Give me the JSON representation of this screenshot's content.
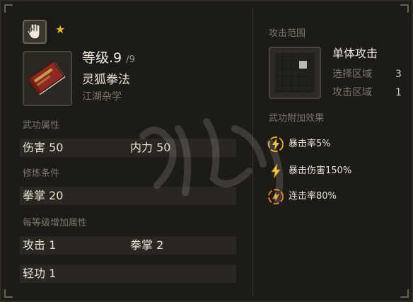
{
  "header": {
    "hand_icon": "hand-icon",
    "star_icon": "star-icon",
    "star_glyph": "★"
  },
  "skill": {
    "level_label": "等级",
    "level_value": ".9",
    "level_max": "/9",
    "name": "灵狐拳法",
    "category": "江湖杂学",
    "book_icon": "book-icon"
  },
  "attributes": {
    "title": "武功属性",
    "items": [
      {
        "label": "伤害",
        "value": "50"
      },
      {
        "label": "内力",
        "value": "50"
      }
    ]
  },
  "requirements": {
    "title": "修炼条件",
    "items": [
      {
        "label": "拳掌",
        "value": "20"
      }
    ]
  },
  "per_level": {
    "title": "每等级增加属性",
    "items": [
      {
        "label": "攻击",
        "value": "1"
      },
      {
        "label": "拳掌",
        "value": "2"
      },
      {
        "label": "轻功",
        "value": "1"
      }
    ]
  },
  "range": {
    "title": "攻击范围",
    "type": "单体攻击",
    "select_label": "选择区域",
    "select_value": "3",
    "attack_label": "攻击区域",
    "attack_value": "1"
  },
  "effects": {
    "title": "武功附加效果",
    "items": [
      {
        "text": "暴击率5%",
        "icon": "lightning-circle-icon"
      },
      {
        "text": "暴击伤害150%",
        "icon": "lightning-icon"
      },
      {
        "text": "连击率80%",
        "icon": "combo-circle-icon"
      }
    ]
  },
  "colors": {
    "accent": "#e6b532",
    "text": "#e8e2d4",
    "muted": "#7c766a",
    "panel": "#1d1b18"
  }
}
